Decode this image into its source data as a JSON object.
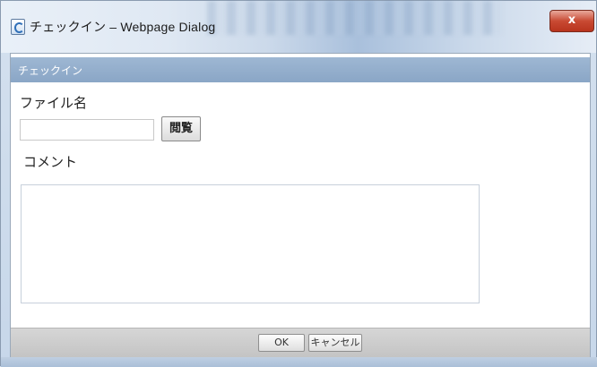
{
  "window": {
    "title": "チェックイン – Webpage Dialog",
    "close_label": "x",
    "icon": "ie-page-icon"
  },
  "dialog": {
    "header_title": "チェックイン",
    "file_label": "ファイル名",
    "file_value": "",
    "browse_label": "閲覧",
    "comment_label": "コメント",
    "comment_value": ""
  },
  "footer": {
    "ok_label": "OK",
    "cancel_label": "キャンセル"
  },
  "colors": {
    "header_bg": "#9eb7d3",
    "close_red": "#c94a33",
    "footer_bg": "#cfcfcf"
  }
}
